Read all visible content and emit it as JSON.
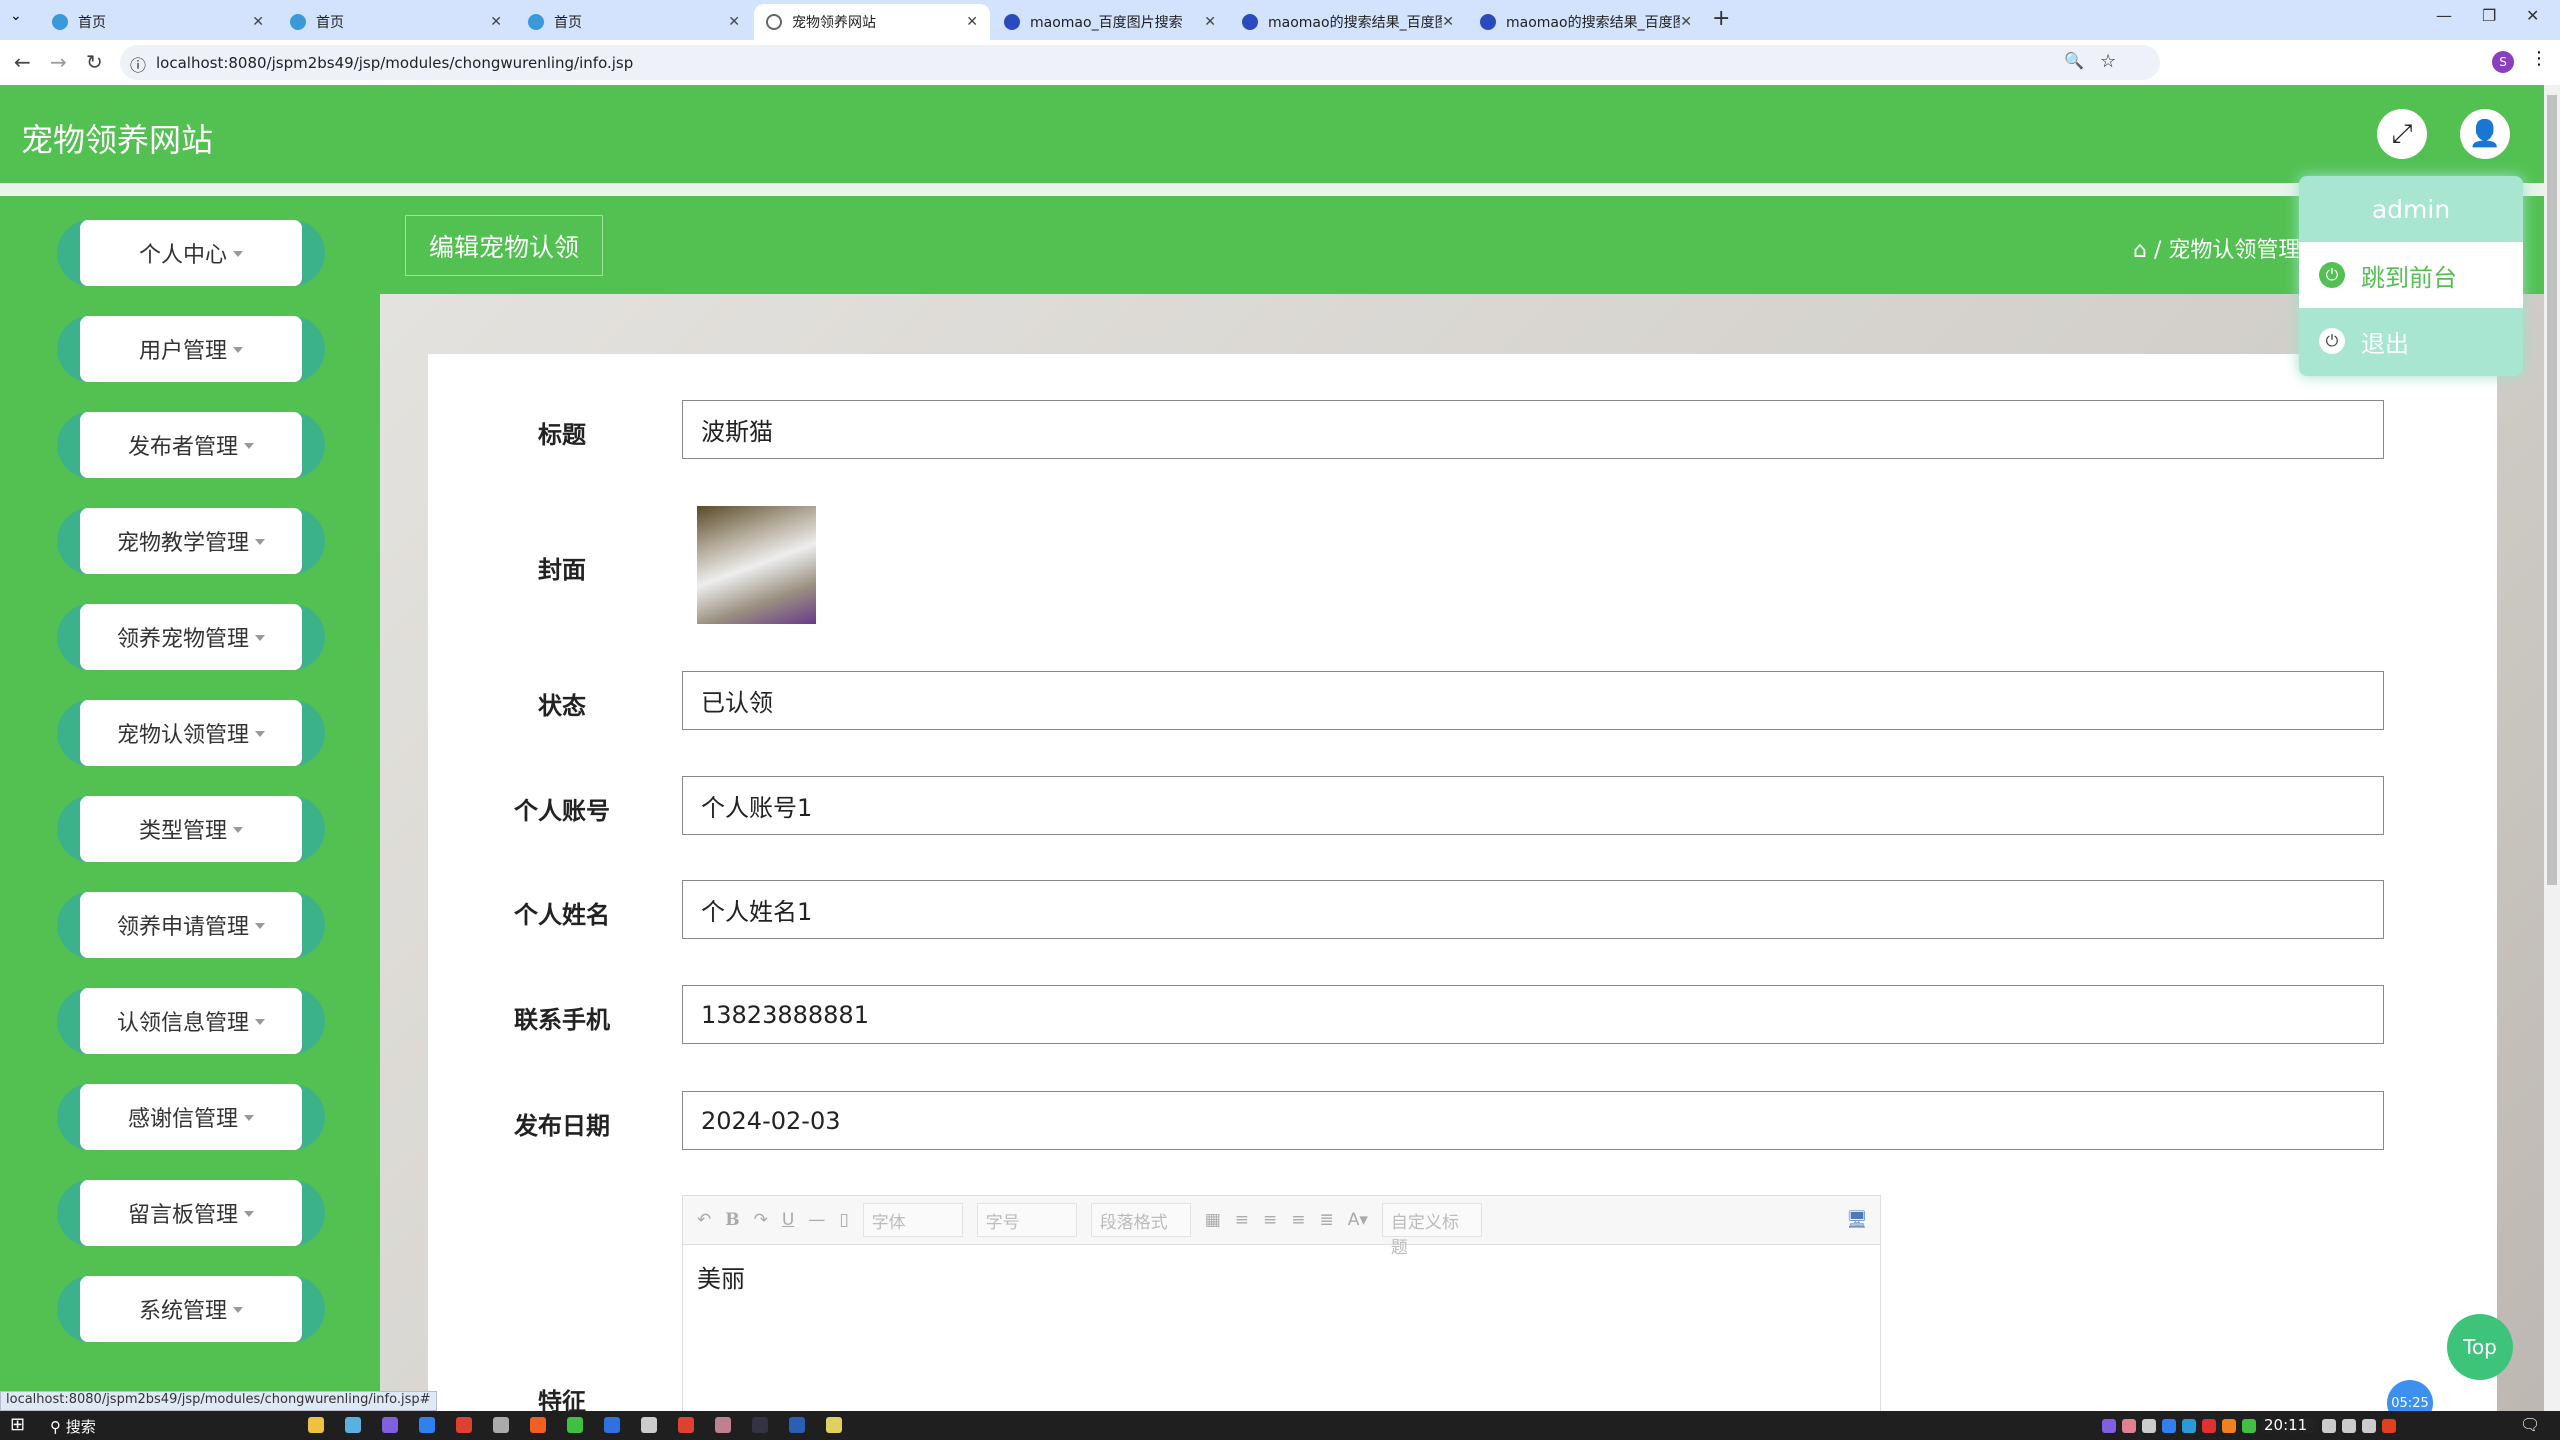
{
  "browser": {
    "tabs": [
      {
        "title": "首页",
        "active": false
      },
      {
        "title": "首页",
        "active": false
      },
      {
        "title": "首页",
        "active": false
      },
      {
        "title": "宠物领养网站",
        "active": true
      },
      {
        "title": "maomao_百度图片搜索",
        "active": false
      },
      {
        "title": "maomao的搜索结果_百度图片",
        "active": false
      },
      {
        "title": "maomao的搜索结果_百度图片",
        "active": false
      }
    ],
    "new_tab": "+",
    "url": "localhost:8080/jspm2bs49/jsp/modules/chongwurenling/info.jsp",
    "status_url": "localhost:8080/jspm2bs49/jsp/modules/chongwurenling/info.jsp#"
  },
  "header": {
    "title": "宠物领养网站"
  },
  "user_menu": {
    "username": "admin",
    "items": [
      {
        "label": "跳到前台"
      },
      {
        "label": "退出"
      }
    ]
  },
  "sidebar": {
    "items": [
      {
        "label": "个人中心"
      },
      {
        "label": "用户管理"
      },
      {
        "label": "发布者管理"
      },
      {
        "label": "宠物教学管理"
      },
      {
        "label": "领养宠物管理"
      },
      {
        "label": "宠物认领管理"
      },
      {
        "label": "类型管理"
      },
      {
        "label": "领养申请管理"
      },
      {
        "label": "认领信息管理"
      },
      {
        "label": "感谢信管理"
      },
      {
        "label": "留言板管理"
      },
      {
        "label": "系统管理"
      }
    ]
  },
  "page": {
    "title": "编辑宠物认领",
    "breadcrumb": "/ 宠物认领管理"
  },
  "form": {
    "title_label": "标题",
    "title_value": "波斯猫",
    "cover_label": "封面",
    "status_label": "状态",
    "status_value": "已认领",
    "account_label": "个人账号",
    "account_value": "个人账号1",
    "name_label": "个人姓名",
    "name_value": "个人姓名1",
    "phone_label": "联系手机",
    "phone_value": "13823888881",
    "date_label": "发布日期",
    "date_value": "2024-02-03",
    "feature_label": "特征",
    "editor": {
      "font": "字体",
      "size": "字号",
      "paragraph": "段落格式",
      "custom_title": "自定义标题",
      "content": "美丽"
    }
  },
  "top_button": "Top",
  "timer": "05:25",
  "taskbar": {
    "search": "搜索",
    "time": "20:11"
  },
  "colors": {
    "primary": "#52c152",
    "pill": "#3cb28a",
    "dropdown": "#a8e6d2"
  }
}
